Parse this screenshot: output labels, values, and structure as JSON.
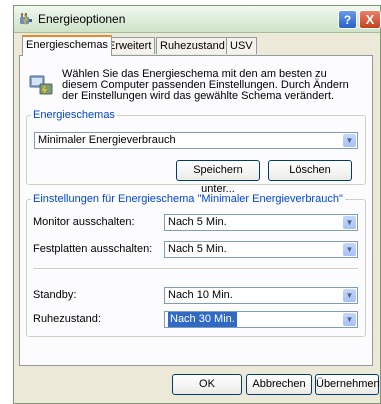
{
  "window": {
    "title": "Energieoptionen",
    "help_label": "?",
    "close_label": "X"
  },
  "tabs": [
    {
      "label": "Energieschemas",
      "active": true
    },
    {
      "label": "Erweitert",
      "active": false
    },
    {
      "label": "Ruhezustand",
      "active": false
    },
    {
      "label": "USV",
      "active": false
    }
  ],
  "description": "Wählen Sie das Energieschema mit den am besten zu diesem Computer passenden Einstellungen. Durch Ändern der Einstellungen wird das gewählte Schema verändert.",
  "schemes_group": {
    "legend": "Energieschemas",
    "selected_scheme": "Minimaler Energieverbrauch",
    "save_as_label": "Speichern unter...",
    "delete_label": "Löschen"
  },
  "settings_group": {
    "legend": "Einstellungen für Energieschema \"Minimaler Energieverbrauch\"",
    "rows": [
      {
        "label": "Monitor ausschalten:",
        "value": "Nach 5 Min."
      },
      {
        "label": "Festplatten ausschalten:",
        "value": "Nach 5 Min."
      },
      {
        "label": "Standby:",
        "value": "Nach 10 Min."
      },
      {
        "label": "Ruhezustand:",
        "value": "Nach 30 Min."
      }
    ]
  },
  "footer": {
    "ok_label": "OK",
    "cancel_label": "Abbrechen",
    "apply_label": "Übernehmen"
  },
  "colors": {
    "accent": "#0046d5",
    "tab_highlight": "#e68b2c",
    "selection": "#316ac5"
  },
  "icons": {
    "app": "power-plug-icon",
    "description": "power-schemes-icon"
  }
}
